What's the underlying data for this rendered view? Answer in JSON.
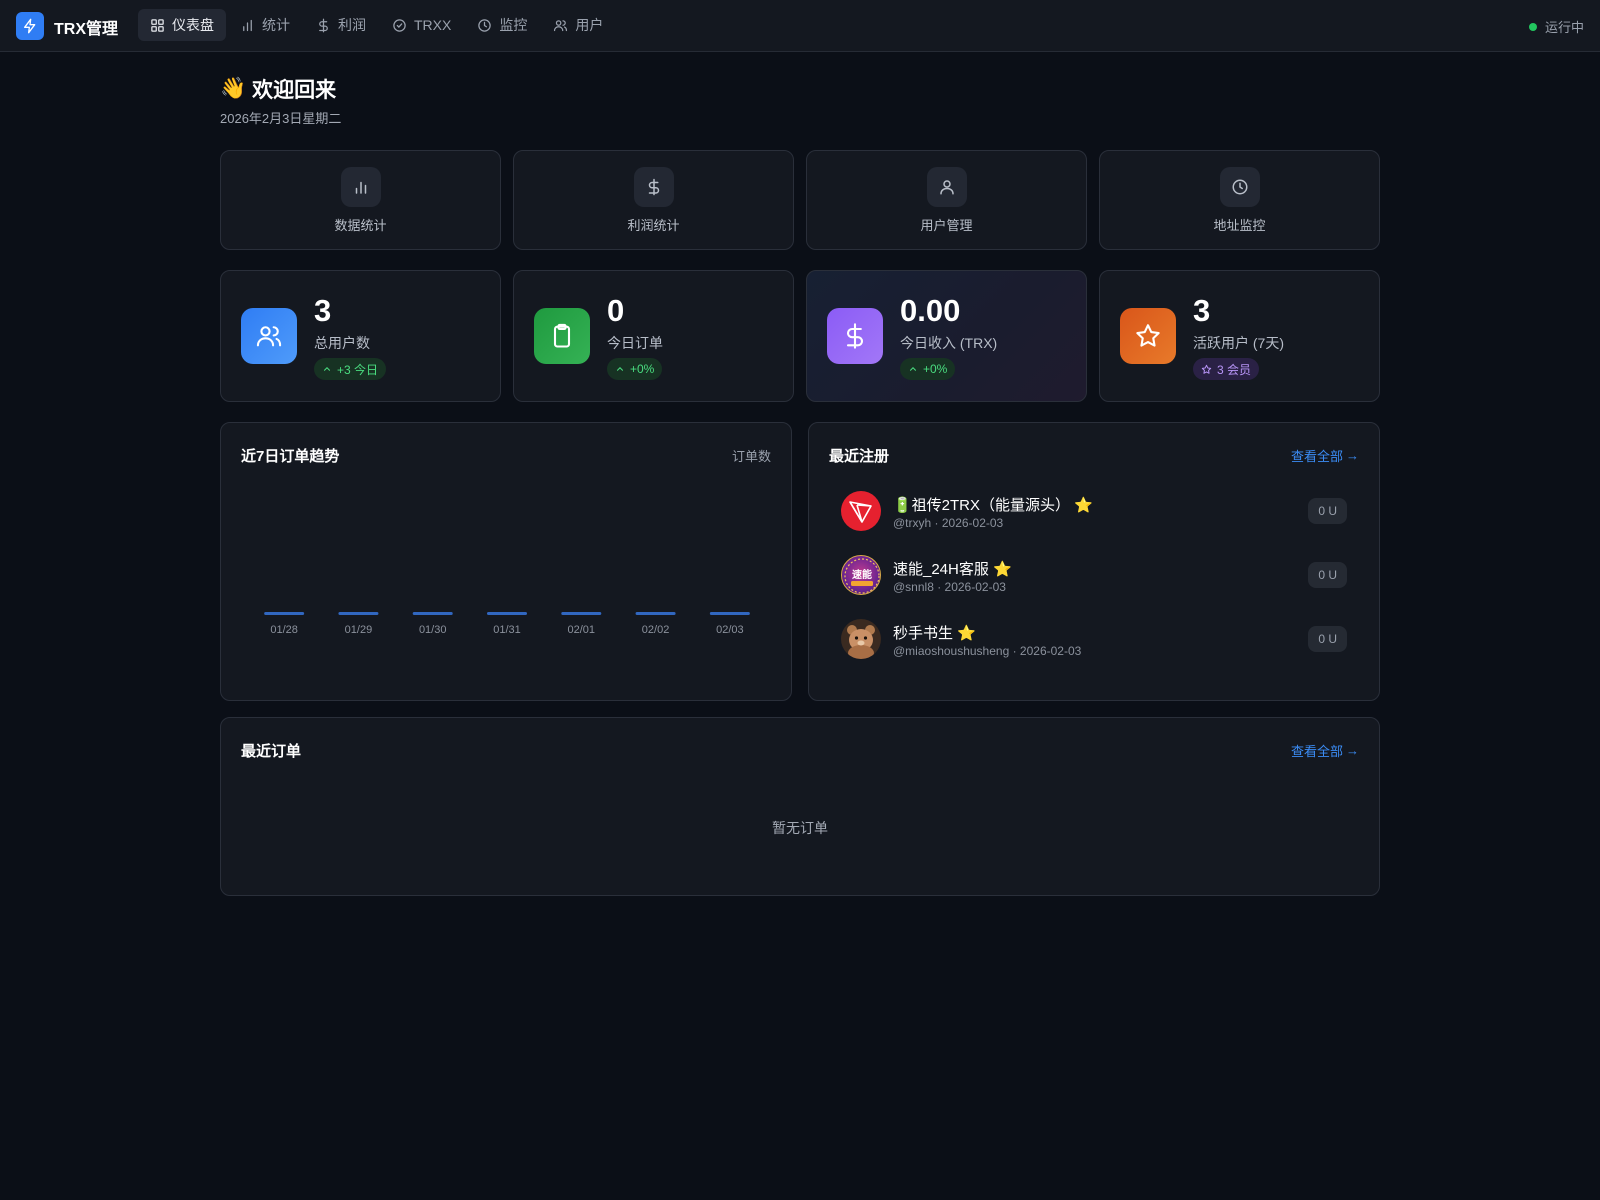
{
  "app": {
    "title": "TRX管理",
    "status": "运行中"
  },
  "nav": [
    {
      "label": "仪表盘",
      "icon": "dashboard-icon"
    },
    {
      "label": "统计",
      "icon": "bar-chart-icon"
    },
    {
      "label": "利润",
      "icon": "dollar-icon"
    },
    {
      "label": "TRXX",
      "icon": "check-circle-icon"
    },
    {
      "label": "监控",
      "icon": "clock-icon"
    },
    {
      "label": "用户",
      "icon": "users-icon"
    }
  ],
  "header": {
    "emoji": "👋",
    "greeting": "欢迎回来",
    "date": "2026年2月3日星期二"
  },
  "quick_links": [
    {
      "label": "数据统计",
      "icon": "bar-chart-icon"
    },
    {
      "label": "利润统计",
      "icon": "dollar-icon"
    },
    {
      "label": "用户管理",
      "icon": "user-icon"
    },
    {
      "label": "地址监控",
      "icon": "clock-icon"
    }
  ],
  "stats": [
    {
      "value": "3",
      "label": "总用户数",
      "badge": "+3 今日",
      "icon": "users-icon",
      "color": "#3b82f6"
    },
    {
      "value": "0",
      "label": "今日订单",
      "badge": "+0%",
      "icon": "clipboard-icon",
      "color": "#22a045"
    },
    {
      "value": "0.00",
      "label": "今日收入 (TRX)",
      "badge": "+0%",
      "icon": "dollar-icon",
      "color": "#8b5cf6"
    },
    {
      "value": "3",
      "label": "活跃用户 (7天)",
      "badge": "3 会员",
      "icon": "star-icon",
      "color": "#e0641c"
    }
  ],
  "chart_panel": {
    "title": "近7日订单趋势",
    "legend": "订单数"
  },
  "chart_data": {
    "type": "bar",
    "title": "近7日订单趋势",
    "categories": [
      "01/28",
      "01/29",
      "01/30",
      "01/31",
      "02/01",
      "02/02",
      "02/03"
    ],
    "series": [
      {
        "name": "订单数",
        "values": [
          0,
          0,
          0,
          0,
          0,
          0,
          0
        ]
      }
    ],
    "color": "#3b82f6",
    "grid": false
  },
  "registrations": {
    "title": "最近注册",
    "view_all": "查看全部",
    "arrow": "→",
    "items": [
      {
        "name": "🔋祖传2TRX（能量源头）",
        "star": "⭐",
        "meta": "@trxyh · 2026-02-03",
        "amount": "0 U",
        "avatar": "tron-logo"
      },
      {
        "name": "速能_24H客服",
        "star": "⭐",
        "meta": "@snnl8 · 2026-02-03",
        "amount": "0 U",
        "avatar": "badge-logo",
        "avatar_text": "速能"
      },
      {
        "name": "秒手书生",
        "star": "⭐",
        "meta": "@miaoshoushusheng · 2026-02-03",
        "amount": "0 U",
        "avatar": "bear-photo"
      }
    ]
  },
  "orders": {
    "title": "最近订单",
    "view_all": "查看全部",
    "arrow": "→",
    "empty": "暂无订单"
  }
}
